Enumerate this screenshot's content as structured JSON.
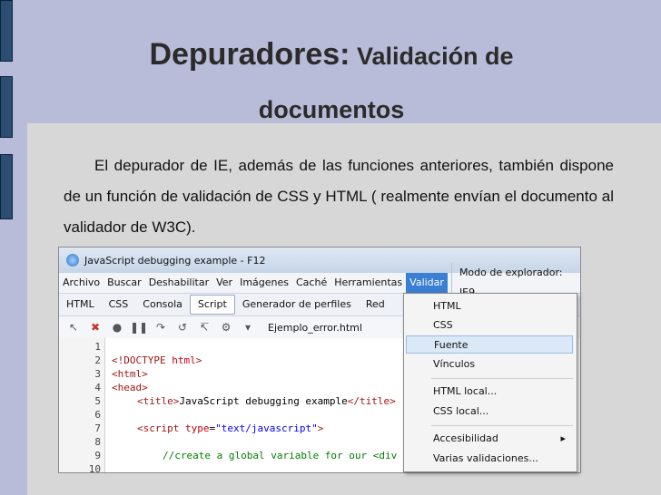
{
  "slide": {
    "title_big": "Depuradores:",
    "title_small": " Validación de",
    "title_line2": "documentos",
    "body": "El depurador de IE, además de las funciones anteriores, también dispone de un función de validación de CSS y HTML ( realmente envían el documento al validador de W3C)."
  },
  "window": {
    "title": "JavaScript debugging example - F12",
    "menu": [
      "Archivo",
      "Buscar",
      "Deshabilitar",
      "Ver",
      "Imágenes",
      "Caché",
      "Herramientas",
      "Validar"
    ],
    "browser_mode": "Modo de explorador: IE9",
    "tabs": [
      "HTML",
      "CSS",
      "Consola",
      "Script",
      "Generador de perfiles",
      "Red"
    ],
    "file": "Ejemplo_error.html"
  },
  "code": {
    "numbers": [
      "1",
      "2",
      "3",
      "4",
      "5",
      "6",
      "7",
      "8",
      "9",
      "10"
    ],
    "line2_a": "<!DOCTYPE ",
    "line2_b": "html",
    "line2_c": ">",
    "line3": "<html>",
    "line4": "<head>",
    "line5_a": "<title>",
    "line5_b": "JavaScript debugging example",
    "line5_c": "</title>",
    "line7_a": "<script ",
    "line7_b": "type",
    "line7_c": "=",
    "line7_d": "\"text/javascript\"",
    "line7_e": ">",
    "line9": "//create a global variable for our <div"
  },
  "dropdown": {
    "items": [
      "HTML",
      "CSS",
      "Fuente",
      "Vínculos",
      "HTML local...",
      "CSS local...",
      "Accesibilidad",
      "Varias validaciones..."
    ]
  }
}
